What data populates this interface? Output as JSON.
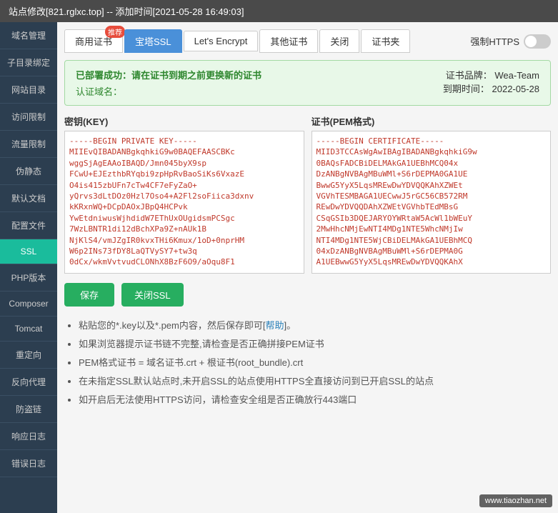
{
  "titleBar": {
    "text": "站点修改[821.rglxc.top] -- 添加时间[2021-05-28 16:49:03]"
  },
  "sidebar": {
    "items": [
      {
        "id": "domain-mgmt",
        "label": "域名管理"
      },
      {
        "id": "subdir-bind",
        "label": "子目录绑定"
      },
      {
        "id": "website-dir",
        "label": "网站目录"
      },
      {
        "id": "access-limit",
        "label": "访问限制"
      },
      {
        "id": "traffic-limit",
        "label": "流量限制"
      },
      {
        "id": "pseudo-static",
        "label": "伪静态"
      },
      {
        "id": "default-doc",
        "label": "默认文档"
      },
      {
        "id": "config-file",
        "label": "配置文件"
      },
      {
        "id": "ssl",
        "label": "SSL",
        "active": true
      },
      {
        "id": "php-version",
        "label": "PHP版本"
      },
      {
        "id": "composer",
        "label": "Composer"
      },
      {
        "id": "tomcat",
        "label": "Tomcat"
      },
      {
        "id": "redirect",
        "label": "重定向"
      },
      {
        "id": "reverse-proxy",
        "label": "反向代理"
      },
      {
        "id": "hotlink-protect",
        "label": "防盗链"
      },
      {
        "id": "access-log",
        "label": "响应日志"
      },
      {
        "id": "error-log",
        "label": "错误日志"
      }
    ]
  },
  "tabs": [
    {
      "id": "commercial-cert",
      "label": "商用证书",
      "badge": "推荐"
    },
    {
      "id": "baota-ssl",
      "label": "宝塔SSL",
      "active": true
    },
    {
      "id": "lets-encrypt",
      "label": "Let's Encrypt"
    },
    {
      "id": "other-cert",
      "label": "其他证书"
    },
    {
      "id": "close",
      "label": "关闭"
    },
    {
      "id": "cert-folder",
      "label": "证书夹"
    }
  ],
  "forceHttps": {
    "label": "强制HTTPS"
  },
  "successBox": {
    "title": "已部署成功：请在证书到期之前更换新的证书",
    "domainLabel": "认证域名：",
    "domainValue": "",
    "brandLabel": "证书品牌：",
    "brandValue": "Wea-Team",
    "expiryLabel": "到期时间：",
    "expiryValue": "2022-05-28"
  },
  "keySection": {
    "label": "密钥(KEY)",
    "content": "-----BEGIN PRIVATE KEY-----\nMIIEvQIBADANBgkqhkiG9w0BAQEFAASCBKc\nwggSjAgEAAoIBAQD/Jmn045byX9sp\nFCwU+EJEzthbRYqbi9zpHpRvBaoSiKs6VxazE\nO4is415zbUFn7cTw4CF7eFyZaO+\nyQrvs3dLtDOz0Hzl7Oso4+A2Fl2soFiica3dxnv\nkKRxnWQ+DCpDAOxJBpQ4HCPvk\nYwEtdniwusWjhdidW7EThUxOUgidsmPCSgc\n7WzLBNTR1di12dBchXPa9Z+nAUk1B\nNjKlS4/vmJZgIR0kvxTHi6Kmux/1oD+0nprHM\nW6p2INs73fDY8LaQTVySY7+tw3q\n0dCx/wkmVvtvudCLONhX8BzF6O9/aOqu8F1"
  },
  "certSection": {
    "label": "证书(PEM格式)",
    "content": "-----BEGIN CERTIFICATE-----\nMIID3TCCAsWgAwIBAgIBADANBgkqhkiG9w\n0BAQsFADCBiDELMAkGA1UEBhMCQ04x\nDzANBgNVBAgMBuWMl+S6rDEPMA0GA1UE\nBwwG5YyX5LqsMREwDwYDVQQKAhXZWEt\nVGVhTESMBAGA1UECwwJ5rGC56CB572RM\nREwDwYDVQQDAhXZWEtVGVhbTEdMBsG\nCSqGSIb3DQEJARYOYWRtaW5AcWl1bWEuY\n2MwHhcNMjEwNTI4MDg1NTE5WhcNMjIw\nNTI4MDg1NTE5WjCBiDELMAkGA1UEBhMCQ\n04xDzANBgNVBAgMBuWMl+S6rDEPMA0G\nA1UEBwwG5YyX5LqsMREwDwYDVQQKAhX"
  },
  "buttons": {
    "save": "保存",
    "closeSSL": "关闭SSL"
  },
  "tips": [
    {
      "text": "粘贴您的*.key以及*.pem内容，然后保存即可[",
      "link": "帮助",
      "after": "]。"
    },
    {
      "text": "如果浏览器提示证书链不完整,请检查是否正确拼接PEM证书"
    },
    {
      "text": "PEM格式证书 = 域名证书.crt + 根证书(root_bundle).crt"
    },
    {
      "text": "在未指定SSL默认站点时,未开启SSL的站点使用HTTPS全直接访问到已开启SSL的站点"
    },
    {
      "text": "如开启后无法使用HTTPS访问，请检查安全组是否正确放行443端口"
    }
  ],
  "watermark": {
    "text": "www.tiaozhan.net"
  }
}
